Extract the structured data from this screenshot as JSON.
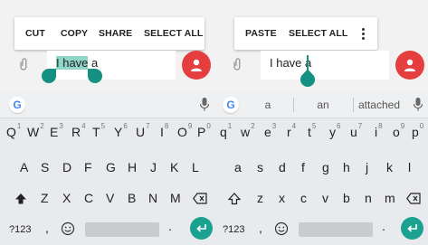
{
  "left_panel": {
    "menu": {
      "cut": "CUT",
      "copy": "COPY",
      "share": "SHARE",
      "select_all": "SELECT ALL"
    },
    "input": {
      "selected_text": "I have",
      "after_text": " a"
    },
    "suggestions": []
  },
  "right_panel": {
    "menu": {
      "paste": "PASTE",
      "select_all": "SELECT ALL"
    },
    "input": {
      "text": "I have a"
    },
    "suggestions": [
      "a",
      "an",
      "attached"
    ]
  },
  "keyboard": {
    "row1": [
      {
        "key": "Q",
        "hint": "1"
      },
      {
        "key": "W",
        "hint": "2"
      },
      {
        "key": "E",
        "hint": "3"
      },
      {
        "key": "R",
        "hint": "4"
      },
      {
        "key": "T",
        "hint": "5"
      },
      {
        "key": "Y",
        "hint": "6"
      },
      {
        "key": "U",
        "hint": "7"
      },
      {
        "key": "I",
        "hint": "8"
      },
      {
        "key": "O",
        "hint": "9"
      },
      {
        "key": "P",
        "hint": "0"
      }
    ],
    "row1_lower": [
      {
        "key": "q",
        "hint": "1"
      },
      {
        "key": "w",
        "hint": "2"
      },
      {
        "key": "e",
        "hint": "3"
      },
      {
        "key": "r",
        "hint": "4"
      },
      {
        "key": "t",
        "hint": "5"
      },
      {
        "key": "y",
        "hint": "6"
      },
      {
        "key": "u",
        "hint": "7"
      },
      {
        "key": "i",
        "hint": "8"
      },
      {
        "key": "o",
        "hint": "9"
      },
      {
        "key": "p",
        "hint": "0"
      }
    ],
    "row2": [
      "A",
      "S",
      "D",
      "F",
      "G",
      "H",
      "J",
      "K",
      "L"
    ],
    "row2_lower": [
      "a",
      "s",
      "d",
      "f",
      "g",
      "h",
      "j",
      "k",
      "l"
    ],
    "row3": [
      "Z",
      "X",
      "C",
      "V",
      "B",
      "N",
      "M"
    ],
    "row3_lower": [
      "z",
      "x",
      "c",
      "v",
      "b",
      "n",
      "m"
    ],
    "symbols_label": "?123",
    "comma": ",",
    "period": "."
  },
  "colors": {
    "accent": "#159183",
    "selection": "#8fd6c9",
    "fab": "#e53e3e",
    "keyboard_bg": "#e8eaed"
  },
  "icons": [
    "paperclip-icon",
    "person-icon",
    "google-icon",
    "mic-icon",
    "shift-icon",
    "backspace-icon",
    "emoji-icon",
    "enter-icon",
    "more-vert-icon"
  ]
}
